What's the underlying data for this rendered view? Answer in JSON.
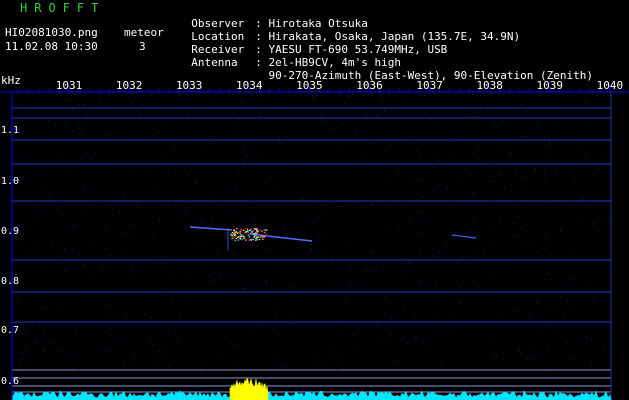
{
  "header": {
    "app_title": "HROFFT",
    "file_name": "HI02081030.png",
    "date_time": "11.02.08 10:30",
    "meteor_label": "meteor",
    "meteor_count": "3"
  },
  "info": [
    {
      "key": "Observer",
      "value": "Hirotaka Otsuka"
    },
    {
      "key": "Location",
      "value": "Hirakata, Osaka, Japan (135.7E, 34.9N)"
    },
    {
      "key": "Receiver",
      "value": "YAESU FT-690 53.749MHz, USB"
    },
    {
      "key": "Antenna",
      "value": "2el-HB9CV, 4m's high"
    },
    {
      "key": "",
      "value": "90-270-Azimuth (East-West), 90-Elevation (Zenith)"
    }
  ],
  "axis": {
    "unit": "kHz",
    "time_ticks": [
      "1031",
      "1032",
      "1033",
      "1034",
      "1035",
      "1036",
      "1037",
      "1038",
      "1039",
      "1040"
    ],
    "freq_ticks": [
      "1.1",
      "1.0",
      "0.9",
      "0.8",
      "0.7",
      "0.6"
    ]
  },
  "colors": {
    "title": "#2ecc40",
    "axis": "#0000ff",
    "line": "#3040ff",
    "spectrum": "#00e5ff",
    "signal": "#ffff00"
  }
}
